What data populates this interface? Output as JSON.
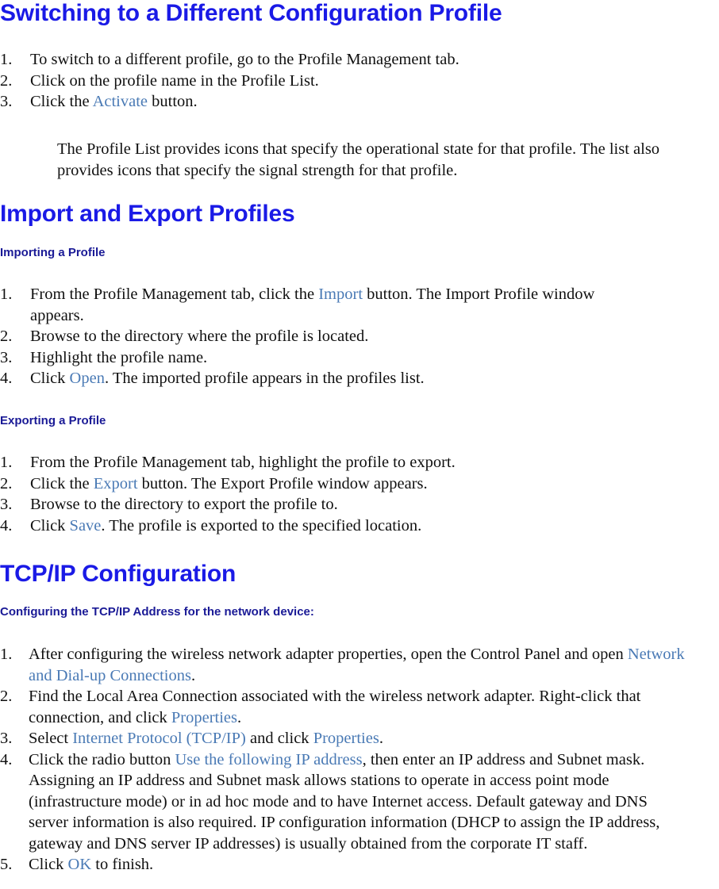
{
  "document": {
    "title": "Switching to a Different Configuration Profile"
  },
  "sections": {
    "switching": {
      "heading": "Switching to a Different Configuration Profile",
      "steps": [
        {
          "num": "1.",
          "pre": "To switch to a different profile, go to the Profile Management tab.",
          "link": "",
          "post": ""
        },
        {
          "num": "2.",
          "pre": "Click on the profile name in the Profile List.",
          "link": "",
          "post": ""
        },
        {
          "num": "3.",
          "pre": "Click the ",
          "link": "Activate",
          "post": " button."
        }
      ],
      "paragraph": "The Profile List provides icons that specify the operational state for that profile. The list also provides icons that specify the signal strength for that profile."
    },
    "import_export": {
      "heading": "Import and Export Profiles",
      "importing": {
        "subheading": "Importing a Profile",
        "steps": [
          {
            "num": "1.",
            "pre": "From the Profile Management tab, click the ",
            "link": "Import",
            "post": " button. The Import Profile window appears."
          },
          {
            "num": "2.",
            "pre": "Browse to the directory where the profile is located.",
            "link": "",
            "post": ""
          },
          {
            "num": "3.",
            "pre": "Highlight the profile name.",
            "link": "",
            "post": ""
          },
          {
            "num": "4.",
            "pre": "Click ",
            "link": "Open",
            "post": ". The imported profile appears in the profiles list."
          }
        ]
      },
      "exporting": {
        "subheading": "Exporting a Profile",
        "steps": [
          {
            "num": "1.",
            "pre": "From the Profile Management tab, highlight the profile to export.",
            "link": "",
            "post": ""
          },
          {
            "num": "2.",
            "pre": "Click the ",
            "link": "Export",
            "post": " button. The Export Profile window appears."
          },
          {
            "num": "3.",
            "pre": "Browse to the directory to export the profile to.",
            "link": "",
            "post": ""
          },
          {
            "num": "4.",
            "pre": "Click ",
            "link": "Save",
            "post": ". The profile is exported to the specified location."
          }
        ]
      }
    },
    "tcpip": {
      "heading": "TCP/IP Configuration",
      "subheading": "Configuring the TCP/IP Address for the network device:",
      "steps": [
        {
          "num": "1.",
          "pre": "After configuring the wireless network adapter properties, open the Control Panel and open ",
          "link": "Network and Dial-up Connections",
          "post": "."
        },
        {
          "num": "2.",
          "pre": "Find the Local Area Connection associated with the wireless network adapter. Right-click that connection, and click ",
          "link": "Properties",
          "post": "."
        },
        {
          "num": "3.",
          "pre": "Select ",
          "link": "Internet Protocol (TCP/IP)",
          "post": " and click ",
          "link2": "Properties",
          "post2": "."
        },
        {
          "num": "4.",
          "pre": "Click the radio button ",
          "link": "Use the following IP address",
          "post": ", then enter an IP address and Subnet mask. Assigning an IP address and Subnet mask allows stations to operate in access point mode (infrastructure mode) or in ad hoc mode and to have Internet access. Default gateway and DNS server information is also required.  IP configuration information (DHCP to assign the IP address, gateway and DNS server IP addresses) is usually obtained from the corporate IT staff."
        },
        {
          "num": "5.",
          "pre": "Click ",
          "link": "OK",
          "post": " to finish."
        }
      ]
    }
  },
  "colors": {
    "heading_blue": "#1a1ae6",
    "subheading_blue": "#1a1a96",
    "ui_reference_blue": "#4a7ab5",
    "body_text": "#101010",
    "page_background": "#ffffff"
  }
}
